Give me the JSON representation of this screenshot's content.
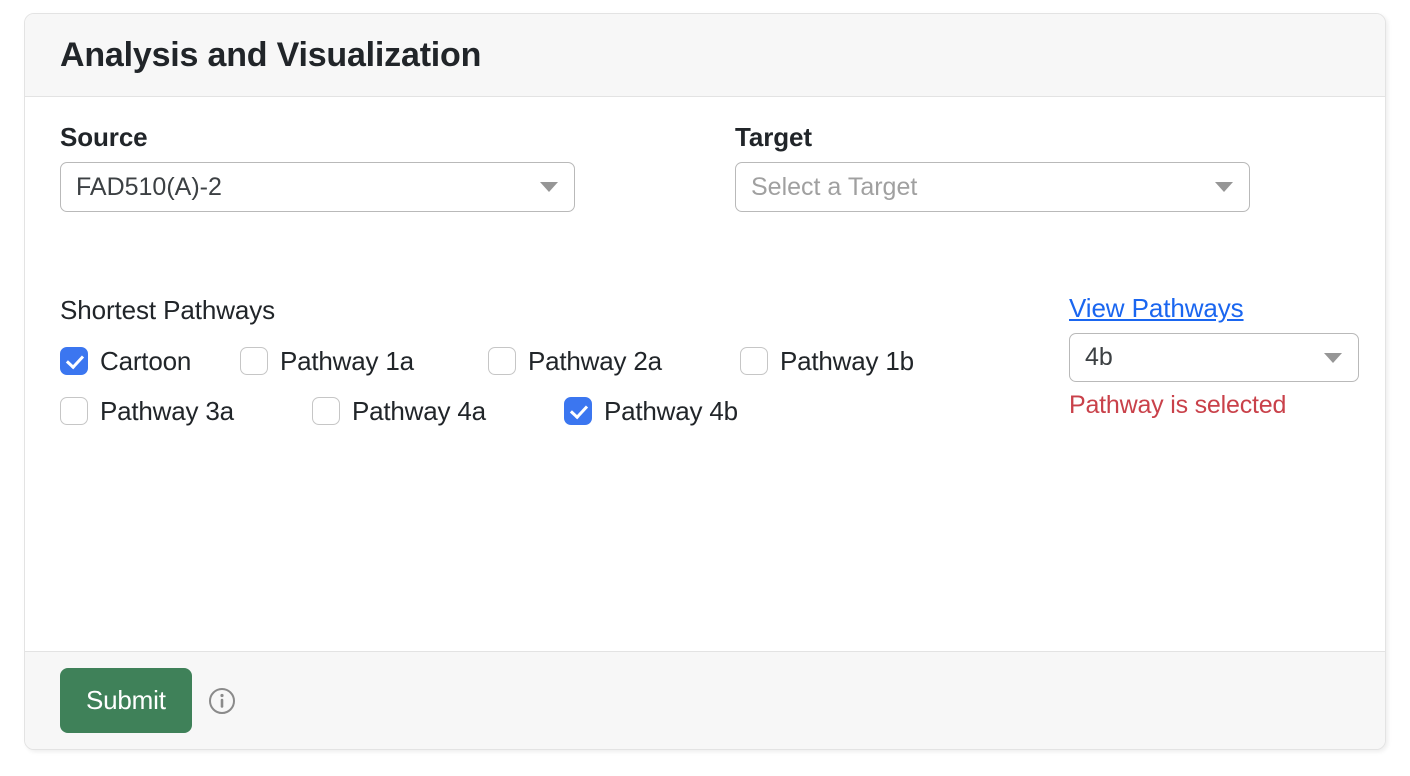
{
  "card": {
    "title": "Analysis and Visualization"
  },
  "source": {
    "label": "Source",
    "value": "FAD510(A)-2",
    "caret_icon": "chevron-down-icon"
  },
  "target": {
    "label": "Target",
    "placeholder": "Select a Target",
    "value": "Select a Target",
    "caret_icon": "chevron-down-icon"
  },
  "pathways": {
    "label": "Shortest Pathways",
    "items": [
      {
        "label": "Cartoon",
        "checked": true
      },
      {
        "label": "Pathway 1a",
        "checked": false
      },
      {
        "label": "Pathway 2a",
        "checked": false
      },
      {
        "label": "Pathway 1b",
        "checked": false
      },
      {
        "label": "Pathway 3a",
        "checked": false
      },
      {
        "label": "Pathway 4a",
        "checked": false
      },
      {
        "label": "Pathway 4b",
        "checked": true
      }
    ]
  },
  "view_pane": {
    "link_label": "View Pathways",
    "selected_pathway": "4b",
    "status_message": "Pathway is selected",
    "caret_icon": "chevron-down-icon"
  },
  "footer": {
    "submit_label": "Submit",
    "info_icon": "info-circle-icon"
  },
  "colors": {
    "accent_blue": "#3b76f0",
    "link_blue": "#1a66f0",
    "submit_green": "#3f8159",
    "status_red": "#c9414a",
    "header_bg": "#f7f7f7",
    "border": "#e3e3e3"
  }
}
